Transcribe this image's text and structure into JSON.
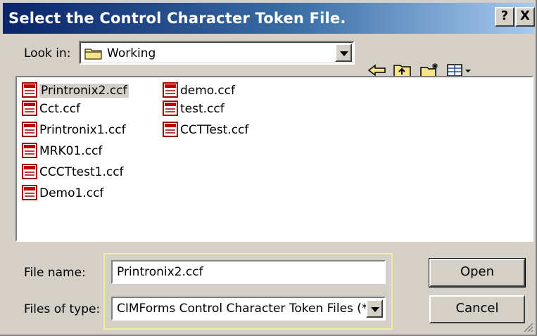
{
  "window": {
    "title": "Select the Control Character Token File.",
    "help_label": "?",
    "close_label": "X"
  },
  "look_in": {
    "label": "Look in:",
    "value": "Working"
  },
  "toolbar": {
    "icons": [
      "back-arrow-icon",
      "up-folder-icon",
      "new-folder-icon",
      "view-menu-icon"
    ]
  },
  "files": {
    "col1": [
      "Printronix2.ccf",
      "Cct.ccf",
      "Printronix1.ccf",
      "MRK01.ccf",
      "CCCTtest1.ccf",
      "Demo1.ccf"
    ],
    "col2": [
      "demo.ccf",
      "test.ccf",
      "CCTTest.ccf"
    ],
    "selected": "Printronix2.ccf"
  },
  "file_name": {
    "label": "File name:",
    "value": "Printronix2.ccf"
  },
  "file_type": {
    "label": "Files of type:",
    "value": "CIMForms Control Character Token Files (*.c"
  },
  "buttons": {
    "open": "Open",
    "cancel": "Cancel"
  }
}
